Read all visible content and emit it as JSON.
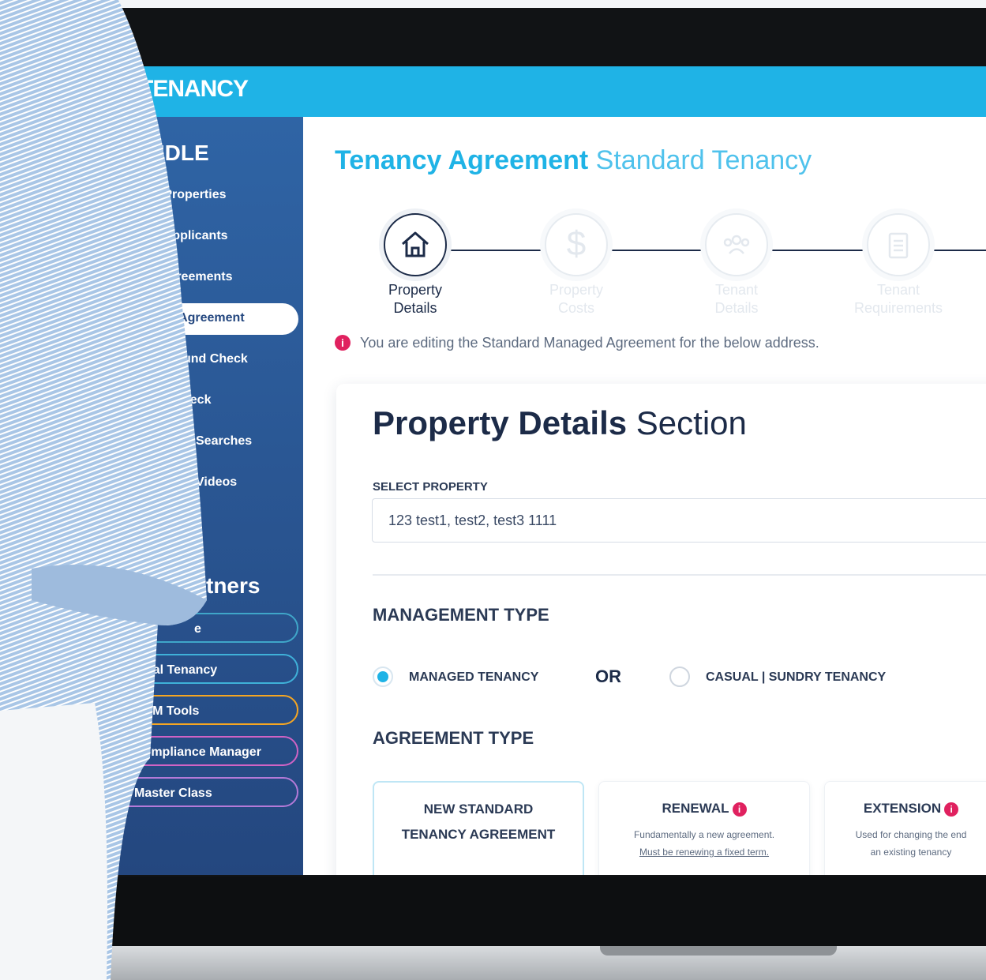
{
  "brand": {
    "name": "TENANCY",
    "color": "#1fb3e6"
  },
  "sidebar": {
    "section_title": "BUNDLE",
    "items": [
      {
        "label": "y Properties"
      },
      {
        "label": "y Applicants"
      },
      {
        "label": "Agreements"
      },
      {
        "label": "te Agreement",
        "active": true
      },
      {
        "label": "round Check"
      },
      {
        "label": "heck"
      },
      {
        "label": "Searches"
      },
      {
        "label": "Videos"
      }
    ],
    "partners_title": "tners",
    "partner_links": [
      {
        "label": "e",
        "icon": "pill-icon"
      },
      {
        "label": "Total Tenancy",
        "icon": "crown-icon"
      },
      {
        "label": "BDM Tools",
        "icon": "megaphone-icon"
      },
      {
        "label": "Compliance Manager",
        "icon": "monitor-icon"
      },
      {
        "label": "Master Class",
        "icon": "graduation-cap-icon"
      }
    ]
  },
  "page": {
    "title_bold": "Tenancy Agreement",
    "title_light": "Standard Tenancy",
    "steps": [
      {
        "label_line1": "Property",
        "label_line2": "Details",
        "icon": "house-icon",
        "active": true
      },
      {
        "label_line1": "Property",
        "label_line2": "Costs",
        "icon": "dollar-icon",
        "active": false
      },
      {
        "label_line1": "Tenant",
        "label_line2": "Details",
        "icon": "people-icon",
        "active": false
      },
      {
        "label_line1": "Tenant",
        "label_line2": "Requirements",
        "icon": "clipboard-icon",
        "active": false
      }
    ],
    "notice": "You are editing the Standard Managed Agreement for the below address."
  },
  "section": {
    "title_bold": "Property Details",
    "title_light": "Section",
    "select_property_label": "SELECT PROPERTY",
    "select_property_value": "123 test1, test2, test3 1111",
    "management_type_label": "MANAGEMENT TYPE",
    "management_options": [
      {
        "label": "MANAGED TENANCY",
        "selected": true
      },
      {
        "label": "CASUAL | SUNDRY TENANCY",
        "selected": false
      }
    ],
    "or_text": "OR",
    "agreement_type_label": "AGREEMENT TYPE",
    "agreement_options": [
      {
        "title_line1": "NEW STANDARD",
        "title_line2": "TENANCY AGREEMENT",
        "desc1": "",
        "desc2": "",
        "selected": true
      },
      {
        "title_line1": "RENEWAL",
        "title_line2": "",
        "desc1": "Fundamentally a new agreement.",
        "desc2": "Must be renewing a fixed term.",
        "selected": false
      },
      {
        "title_line1": "EXTENSION",
        "title_line2": "",
        "desc1": "Used for changing the end",
        "desc2": "an existing tenancy",
        "selected": false
      }
    ]
  }
}
